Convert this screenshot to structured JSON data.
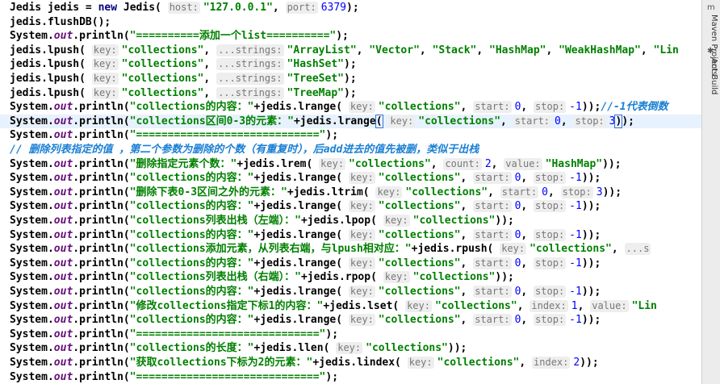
{
  "editor": {
    "lines": [
      {
        "segs": [
          [
            "plain",
            "Jedis jedis = "
          ],
          [
            "kw",
            "new "
          ],
          [
            "plain",
            "Jedis( "
          ],
          [
            "hint",
            "host:"
          ],
          [
            "str",
            "\"127.0.0.1\""
          ],
          [
            "plain",
            ", "
          ],
          [
            "hint",
            "port:"
          ],
          [
            "num",
            "6379"
          ],
          [
            "plain",
            ");"
          ]
        ]
      },
      {
        "segs": [
          [
            "plain",
            "jedis.flushDB();"
          ]
        ]
      },
      {
        "segs": [
          [
            "plain",
            "System."
          ],
          [
            "field",
            "out"
          ],
          [
            "plain",
            ".println("
          ],
          [
            "str",
            "\"==========添加一个list==========\""
          ],
          [
            "plain",
            ");"
          ]
        ]
      },
      {
        "segs": [
          [
            "plain",
            "jedis.lpush( "
          ],
          [
            "hint",
            "key:"
          ],
          [
            "str",
            "\"collections\""
          ],
          [
            "plain",
            ", "
          ],
          [
            "hint",
            "...strings:"
          ],
          [
            "str",
            "\"ArrayList\""
          ],
          [
            "plain",
            ", "
          ],
          [
            "str",
            "\"Vector\""
          ],
          [
            "plain",
            ", "
          ],
          [
            "str",
            "\"Stack\""
          ],
          [
            "plain",
            ", "
          ],
          [
            "str",
            "\"HashMap\""
          ],
          [
            "plain",
            ", "
          ],
          [
            "str",
            "\"WeakHashMap\""
          ],
          [
            "plain",
            ", "
          ],
          [
            "str",
            "\"Lin"
          ]
        ]
      },
      {
        "segs": [
          [
            "plain",
            "jedis.lpush( "
          ],
          [
            "hint",
            "key:"
          ],
          [
            "str",
            "\"collections\""
          ],
          [
            "plain",
            ", "
          ],
          [
            "hint",
            "...strings:"
          ],
          [
            "str",
            "\"HashSet\""
          ],
          [
            "plain",
            ");"
          ]
        ]
      },
      {
        "segs": [
          [
            "plain",
            "jedis.lpush( "
          ],
          [
            "hint",
            "key:"
          ],
          [
            "str",
            "\"collections\""
          ],
          [
            "plain",
            ", "
          ],
          [
            "hint",
            "...strings:"
          ],
          [
            "str",
            "\"TreeSet\""
          ],
          [
            "plain",
            ");"
          ]
        ]
      },
      {
        "segs": [
          [
            "plain",
            "jedis.lpush( "
          ],
          [
            "hint",
            "key:"
          ],
          [
            "str",
            "\"collections\""
          ],
          [
            "plain",
            ", "
          ],
          [
            "hint",
            "...strings:"
          ],
          [
            "str",
            "\"TreeMap\""
          ],
          [
            "plain",
            ");"
          ]
        ]
      },
      {
        "segs": [
          [
            "plain",
            "System."
          ],
          [
            "field",
            "out"
          ],
          [
            "plain",
            ".println("
          ],
          [
            "str",
            "\"collections的内容：\""
          ],
          [
            "plain",
            "+jedis.lrange( "
          ],
          [
            "hint",
            "key:"
          ],
          [
            "str",
            "\"collections\""
          ],
          [
            "plain",
            ", "
          ],
          [
            "hint",
            "start:"
          ],
          [
            "num",
            "0"
          ],
          [
            "plain",
            ", "
          ],
          [
            "hint",
            "stop:"
          ],
          [
            "num",
            "-1"
          ],
          [
            "plain",
            "));"
          ],
          [
            "cmtb",
            "//-1代表倒数"
          ]
        ]
      },
      {
        "hl": true,
        "segs": [
          [
            "plain",
            "System."
          ],
          [
            "field",
            "out"
          ],
          [
            "plain",
            ".println("
          ],
          [
            "str",
            "\"collections区间0-3的元素：\""
          ],
          [
            "plain",
            "+jedis.lrange"
          ],
          [
            "caret",
            "("
          ],
          [
            "plain",
            " "
          ],
          [
            "hint",
            "key:"
          ],
          [
            "str",
            "\"collections\""
          ],
          [
            "plain",
            ", "
          ],
          [
            "hint",
            "start:"
          ],
          [
            "num",
            "0"
          ],
          [
            "plain",
            ", "
          ],
          [
            "hint",
            "stop:"
          ],
          [
            "num",
            "3"
          ],
          [
            "caret",
            ")"
          ],
          [
            "plain",
            ");"
          ]
        ]
      },
      {
        "segs": [
          [
            "plain",
            "System."
          ],
          [
            "field",
            "out"
          ],
          [
            "plain",
            ".println("
          ],
          [
            "str",
            "\"=============================\""
          ],
          [
            "plain",
            ");"
          ]
        ]
      },
      {
        "segs": [
          [
            "cmtb",
            "// 删除列表指定的值 ，第二个参数为删除的个数（有重复时），后add进去的值先被删，类似于出栈"
          ]
        ]
      },
      {
        "segs": [
          [
            "plain",
            "System."
          ],
          [
            "field",
            "out"
          ],
          [
            "plain",
            ".println("
          ],
          [
            "str",
            "\"删除指定元素个数：\""
          ],
          [
            "plain",
            "+jedis.lrem( "
          ],
          [
            "hint",
            "key:"
          ],
          [
            "str",
            "\"collections\""
          ],
          [
            "plain",
            ", "
          ],
          [
            "hint",
            "count:"
          ],
          [
            "num",
            "2"
          ],
          [
            "plain",
            ", "
          ],
          [
            "hint",
            "value:"
          ],
          [
            "str",
            "\"HashMap\""
          ],
          [
            "plain",
            "));"
          ]
        ]
      },
      {
        "segs": [
          [
            "plain",
            "System."
          ],
          [
            "field",
            "out"
          ],
          [
            "plain",
            ".println("
          ],
          [
            "str",
            "\"collections的内容：\""
          ],
          [
            "plain",
            "+jedis.lrange( "
          ],
          [
            "hint",
            "key:"
          ],
          [
            "str",
            "\"collections\""
          ],
          [
            "plain",
            ", "
          ],
          [
            "hint",
            "start:"
          ],
          [
            "num",
            "0"
          ],
          [
            "plain",
            ", "
          ],
          [
            "hint",
            "stop:"
          ],
          [
            "num",
            "-1"
          ],
          [
            "plain",
            "));"
          ]
        ]
      },
      {
        "segs": [
          [
            "plain",
            "System."
          ],
          [
            "field",
            "out"
          ],
          [
            "plain",
            ".println("
          ],
          [
            "str",
            "\"删除下表0-3区间之外的元素：\""
          ],
          [
            "plain",
            "+jedis.ltrim( "
          ],
          [
            "hint",
            "key:"
          ],
          [
            "str",
            "\"collections\""
          ],
          [
            "plain",
            ", "
          ],
          [
            "hint",
            "start:"
          ],
          [
            "num",
            "0"
          ],
          [
            "plain",
            ", "
          ],
          [
            "hint",
            "stop:"
          ],
          [
            "num",
            "3"
          ],
          [
            "plain",
            "));"
          ]
        ]
      },
      {
        "segs": [
          [
            "plain",
            "System."
          ],
          [
            "field",
            "out"
          ],
          [
            "plain",
            ".println("
          ],
          [
            "str",
            "\"collections的内容：\""
          ],
          [
            "plain",
            "+jedis.lrange( "
          ],
          [
            "hint",
            "key:"
          ],
          [
            "str",
            "\"collections\""
          ],
          [
            "plain",
            ", "
          ],
          [
            "hint",
            "start:"
          ],
          [
            "num",
            "0"
          ],
          [
            "plain",
            ", "
          ],
          [
            "hint",
            "stop:"
          ],
          [
            "num",
            "-1"
          ],
          [
            "plain",
            "));"
          ]
        ]
      },
      {
        "segs": [
          [
            "plain",
            "System."
          ],
          [
            "field",
            "out"
          ],
          [
            "plain",
            ".println("
          ],
          [
            "str",
            "\"collections列表出栈（左端）：\""
          ],
          [
            "plain",
            "+jedis.lpop( "
          ],
          [
            "hint",
            "key:"
          ],
          [
            "str",
            "\"collections\""
          ],
          [
            "plain",
            "));"
          ]
        ]
      },
      {
        "segs": [
          [
            "plain",
            "System."
          ],
          [
            "field",
            "out"
          ],
          [
            "plain",
            ".println("
          ],
          [
            "str",
            "\"collections的内容：\""
          ],
          [
            "plain",
            "+jedis.lrange( "
          ],
          [
            "hint",
            "key:"
          ],
          [
            "str",
            "\"collections\""
          ],
          [
            "plain",
            ", "
          ],
          [
            "hint",
            "start:"
          ],
          [
            "num",
            "0"
          ],
          [
            "plain",
            ", "
          ],
          [
            "hint",
            "stop:"
          ],
          [
            "num",
            "-1"
          ],
          [
            "plain",
            "));"
          ]
        ]
      },
      {
        "segs": [
          [
            "plain",
            "System."
          ],
          [
            "field",
            "out"
          ],
          [
            "plain",
            ".println("
          ],
          [
            "str",
            "\"collections添加元素，从列表右端，与lpush相对应：\""
          ],
          [
            "plain",
            "+jedis.rpush( "
          ],
          [
            "hint",
            "key:"
          ],
          [
            "str",
            "\"collections\""
          ],
          [
            "plain",
            ", "
          ],
          [
            "hint",
            "...s"
          ]
        ]
      },
      {
        "segs": [
          [
            "plain",
            "System."
          ],
          [
            "field",
            "out"
          ],
          [
            "plain",
            ".println("
          ],
          [
            "str",
            "\"collections的内容：\""
          ],
          [
            "plain",
            "+jedis.lrange( "
          ],
          [
            "hint",
            "key:"
          ],
          [
            "str",
            "\"collections\""
          ],
          [
            "plain",
            ", "
          ],
          [
            "hint",
            "start:"
          ],
          [
            "num",
            "0"
          ],
          [
            "plain",
            ", "
          ],
          [
            "hint",
            "stop:"
          ],
          [
            "num",
            "-1"
          ],
          [
            "plain",
            "));"
          ]
        ]
      },
      {
        "segs": [
          [
            "plain",
            "System."
          ],
          [
            "field",
            "out"
          ],
          [
            "plain",
            ".println("
          ],
          [
            "str",
            "\"collections列表出栈（右端）：\""
          ],
          [
            "plain",
            "+jedis.rpop( "
          ],
          [
            "hint",
            "key:"
          ],
          [
            "str",
            "\"collections\""
          ],
          [
            "plain",
            "));"
          ]
        ]
      },
      {
        "segs": [
          [
            "plain",
            "System."
          ],
          [
            "field",
            "out"
          ],
          [
            "plain",
            ".println("
          ],
          [
            "str",
            "\"collections的内容：\""
          ],
          [
            "plain",
            "+jedis.lrange( "
          ],
          [
            "hint",
            "key:"
          ],
          [
            "str",
            "\"collections\""
          ],
          [
            "plain",
            ", "
          ],
          [
            "hint",
            "start:"
          ],
          [
            "num",
            "0"
          ],
          [
            "plain",
            ", "
          ],
          [
            "hint",
            "stop:"
          ],
          [
            "num",
            "-1"
          ],
          [
            "plain",
            "));"
          ]
        ]
      },
      {
        "segs": [
          [
            "plain",
            "System."
          ],
          [
            "field",
            "out"
          ],
          [
            "plain",
            ".println("
          ],
          [
            "str",
            "\"修改collections指定下标1的内容：\""
          ],
          [
            "plain",
            "+jedis.lset( "
          ],
          [
            "hint",
            "key:"
          ],
          [
            "str",
            "\"collections\""
          ],
          [
            "plain",
            ", "
          ],
          [
            "hint",
            "index:"
          ],
          [
            "num",
            "1"
          ],
          [
            "plain",
            ", "
          ],
          [
            "hint",
            "value:"
          ],
          [
            "str",
            "\"Lin"
          ]
        ]
      },
      {
        "segs": [
          [
            "plain",
            "System."
          ],
          [
            "field",
            "out"
          ],
          [
            "plain",
            ".println("
          ],
          [
            "str",
            "\"collections的内容：\""
          ],
          [
            "plain",
            "+jedis.lrange( "
          ],
          [
            "hint",
            "key:"
          ],
          [
            "str",
            "\"collections\""
          ],
          [
            "plain",
            ", "
          ],
          [
            "hint",
            "start:"
          ],
          [
            "num",
            "0"
          ],
          [
            "plain",
            ", "
          ],
          [
            "hint",
            "stop:"
          ],
          [
            "num",
            "-1"
          ],
          [
            "plain",
            "));"
          ]
        ]
      },
      {
        "segs": [
          [
            "plain",
            "System."
          ],
          [
            "field",
            "out"
          ],
          [
            "plain",
            ".println("
          ],
          [
            "str",
            "\"=============================\""
          ],
          [
            "plain",
            ");"
          ]
        ]
      },
      {
        "segs": [
          [
            "plain",
            "System."
          ],
          [
            "field",
            "out"
          ],
          [
            "plain",
            ".println("
          ],
          [
            "str",
            "\"collections的长度：\""
          ],
          [
            "plain",
            "+jedis.llen( "
          ],
          [
            "hint",
            "key:"
          ],
          [
            "str",
            "\"collections\""
          ],
          [
            "plain",
            "));"
          ]
        ]
      },
      {
        "segs": [
          [
            "plain",
            "System."
          ],
          [
            "field",
            "out"
          ],
          [
            "plain",
            ".println("
          ],
          [
            "str",
            "\"获取collections下标为2的元素：\""
          ],
          [
            "plain",
            "+jedis.lindex( "
          ],
          [
            "hint",
            "key:"
          ],
          [
            "str",
            "\"collections\""
          ],
          [
            "plain",
            ", "
          ],
          [
            "hint",
            "index:"
          ],
          [
            "num",
            "2"
          ],
          [
            "plain",
            "));"
          ]
        ]
      },
      {
        "segs": [
          [
            "plain",
            "System."
          ],
          [
            "field",
            "out"
          ],
          [
            "plain",
            ".println("
          ],
          [
            "str",
            "\"=============================\""
          ],
          [
            "plain",
            ");"
          ]
        ]
      }
    ]
  },
  "sidebar": {
    "tabs": [
      {
        "label": "Maven Projects",
        "icon": "maven-icon",
        "icon_glyph": "m"
      },
      {
        "label": "Ant Build",
        "icon": "ant-icon",
        "icon_glyph": "✱"
      }
    ]
  }
}
